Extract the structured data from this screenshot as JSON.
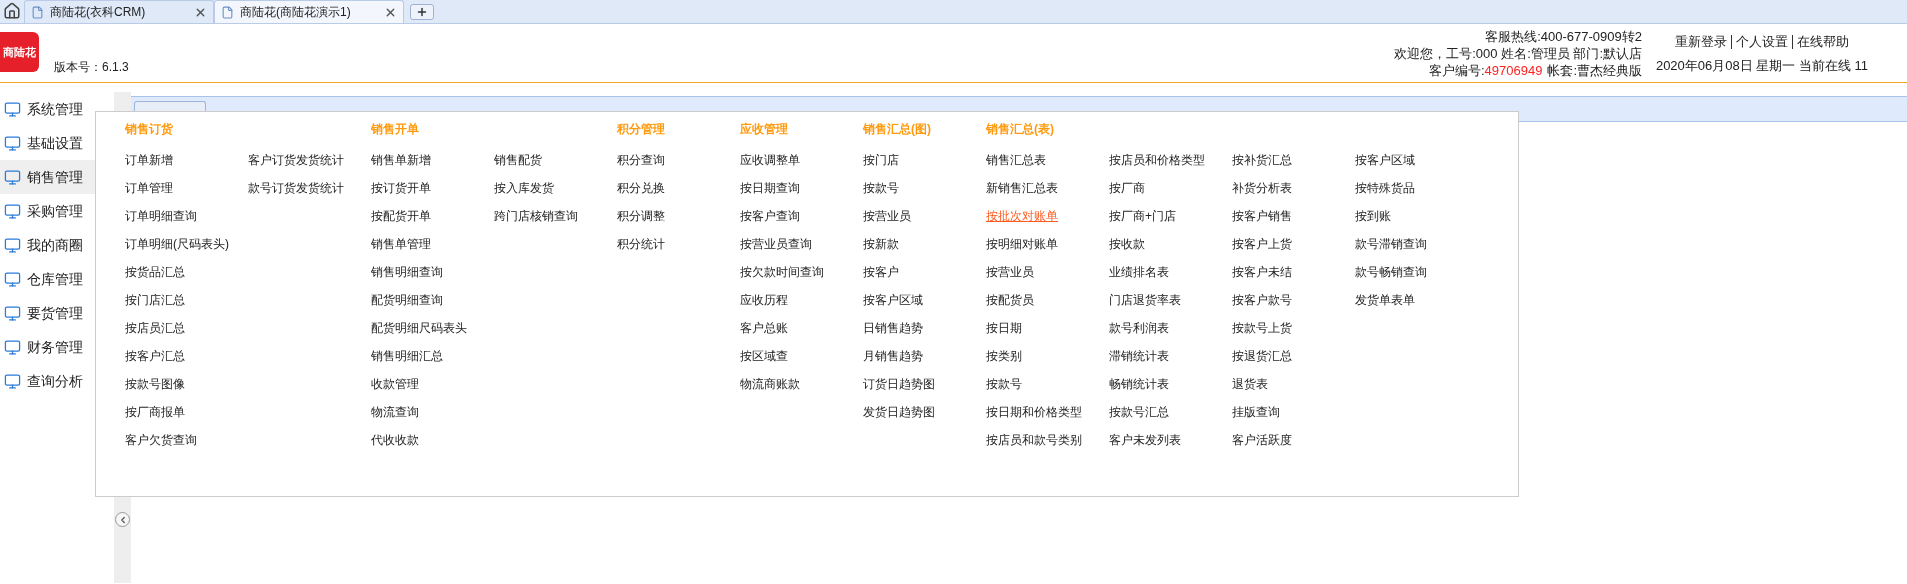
{
  "browser_tabs": [
    {
      "title": "商陆花(衣科CRM)",
      "selected": false
    },
    {
      "title": "商陆花(商陆花演示1)",
      "selected": true
    }
  ],
  "header": {
    "logo": "商陆花",
    "version": "版本号：6.1.3",
    "hotline": "客服热线:400-677-0909转2",
    "welcome": "欢迎您，工号:000 姓名:管理员 部门:默认店",
    "customer_label": "客户编号:",
    "customer_no": "49706949",
    "account": "帐套:曹杰经典版",
    "links": [
      "重新登录",
      "个人设置",
      "在线帮助"
    ],
    "date_line": "2020年06月08日 星期一 当前在线 11"
  },
  "sidebar": {
    "items": [
      {
        "label": "系统管理",
        "selected": false
      },
      {
        "label": "基础设置",
        "selected": false
      },
      {
        "label": "销售管理",
        "selected": true
      },
      {
        "label": "采购管理",
        "selected": false
      },
      {
        "label": "我的商圈",
        "selected": false
      },
      {
        "label": "仓库管理",
        "selected": false
      },
      {
        "label": "要货管理",
        "selected": false
      },
      {
        "label": "财务管理",
        "selected": false
      },
      {
        "label": "查询分析",
        "selected": false
      }
    ]
  },
  "menu": {
    "groups": [
      {
        "title": "销售订货",
        "columns": [
          [
            {
              "label": "订单新增",
              "selected": false
            },
            {
              "label": "订单管理",
              "selected": false
            },
            {
              "label": "订单明细查询",
              "selected": false
            },
            {
              "label": "订单明细(尺码表头)",
              "selected": false
            },
            {
              "label": "按货品汇总",
              "selected": false
            },
            {
              "label": "按门店汇总",
              "selected": false
            },
            {
              "label": "按店员汇总",
              "selected": false
            },
            {
              "label": "按客户汇总",
              "selected": false
            },
            {
              "label": "按款号图像",
              "selected": false
            },
            {
              "label": "按厂商报单",
              "selected": false
            },
            {
              "label": "客户欠货查询",
              "selected": false
            }
          ],
          [
            {
              "label": "客户订货发货统计",
              "selected": false
            },
            {
              "label": "款号订货发货统计",
              "selected": false
            }
          ]
        ]
      },
      {
        "title": "销售开单",
        "columns": [
          [
            {
              "label": "销售单新增",
              "selected": false
            },
            {
              "label": "按订货开单",
              "selected": false
            },
            {
              "label": "按配货开单",
              "selected": false
            },
            {
              "label": "销售单管理",
              "selected": false
            },
            {
              "label": "销售明细查询",
              "selected": false
            },
            {
              "label": "配货明细查询",
              "selected": false
            },
            {
              "label": "配货明细尺码表头",
              "selected": false
            },
            {
              "label": "销售明细汇总",
              "selected": false
            },
            {
              "label": "收款管理",
              "selected": false
            },
            {
              "label": "物流查询",
              "selected": false
            },
            {
              "label": "代收收款",
              "selected": false
            }
          ],
          [
            {
              "label": "销售配货",
              "selected": false
            },
            {
              "label": "按入库发货",
              "selected": false
            },
            {
              "label": "跨门店核销查询",
              "selected": false
            }
          ]
        ]
      },
      {
        "title": "积分管理",
        "columns": [
          [
            {
              "label": "积分查询",
              "selected": false
            },
            {
              "label": "积分兑换",
              "selected": false
            },
            {
              "label": "积分调整",
              "selected": false
            },
            {
              "label": "积分统计",
              "selected": false
            }
          ]
        ]
      },
      {
        "title": "应收管理",
        "columns": [
          [
            {
              "label": "应收调整单",
              "selected": false
            },
            {
              "label": "按日期查询",
              "selected": false
            },
            {
              "label": "按客户查询",
              "selected": false
            },
            {
              "label": "按营业员查询",
              "selected": false
            },
            {
              "label": "按欠款时间查询",
              "selected": false
            },
            {
              "label": "应收历程",
              "selected": false
            },
            {
              "label": "客户总账",
              "selected": false
            },
            {
              "label": "按区域查",
              "selected": false
            },
            {
              "label": "物流商账款",
              "selected": false
            }
          ]
        ]
      },
      {
        "title": "销售汇总(图)",
        "columns": [
          [
            {
              "label": "按门店",
              "selected": false
            },
            {
              "label": "按款号",
              "selected": false
            },
            {
              "label": "按营业员",
              "selected": false
            },
            {
              "label": "按新款",
              "selected": false
            },
            {
              "label": "按客户",
              "selected": false
            },
            {
              "label": "按客户区域",
              "selected": false
            },
            {
              "label": "日销售趋势",
              "selected": false
            },
            {
              "label": "月销售趋势",
              "selected": false
            },
            {
              "label": "订货日趋势图",
              "selected": false
            },
            {
              "label": "发货日趋势图",
              "selected": false
            }
          ]
        ]
      },
      {
        "title": "销售汇总(表)",
        "columns": [
          [
            {
              "label": "销售汇总表",
              "selected": false
            },
            {
              "label": "新销售汇总表",
              "selected": false
            },
            {
              "label": "按批次对账单",
              "selected": true
            },
            {
              "label": "按明细对账单",
              "selected": false
            },
            {
              "label": "按营业员",
              "selected": false
            },
            {
              "label": "按配货员",
              "selected": false
            },
            {
              "label": "按日期",
              "selected": false
            },
            {
              "label": "按类别",
              "selected": false
            },
            {
              "label": "按款号",
              "selected": false
            },
            {
              "label": "按日期和价格类型",
              "selected": false
            },
            {
              "label": "按店员和款号类别",
              "selected": false
            }
          ],
          [
            {
              "label": "按店员和价格类型",
              "selected": false
            },
            {
              "label": "按厂商",
              "selected": false
            },
            {
              "label": "按厂商+门店",
              "selected": false
            },
            {
              "label": "按收款",
              "selected": false
            },
            {
              "label": "业绩排名表",
              "selected": false
            },
            {
              "label": "门店退货率表",
              "selected": false
            },
            {
              "label": "款号利润表",
              "selected": false
            },
            {
              "label": "滞销统计表",
              "selected": false
            },
            {
              "label": "畅销统计表",
              "selected": false
            },
            {
              "label": "按款号汇总",
              "selected": false
            },
            {
              "label": "客户未发列表",
              "selected": false
            }
          ],
          [
            {
              "label": "按补货汇总",
              "selected": false
            },
            {
              "label": "补货分析表",
              "selected": false
            },
            {
              "label": "按客户销售",
              "selected": false
            },
            {
              "label": "按客户上货",
              "selected": false
            },
            {
              "label": "按客户未结",
              "selected": false
            },
            {
              "label": "按客户款号",
              "selected": false
            },
            {
              "label": "按款号上货",
              "selected": false
            },
            {
              "label": "按退货汇总",
              "selected": false
            },
            {
              "label": "退货表",
              "selected": false
            },
            {
              "label": "挂版查询",
              "selected": false
            },
            {
              "label": "客户活跃度",
              "selected": false
            }
          ],
          [
            {
              "label": "按客户区域",
              "selected": false
            },
            {
              "label": "按特殊货品",
              "selected": false
            },
            {
              "label": "按到账",
              "selected": false
            },
            {
              "label": "款号滞销查询",
              "selected": false
            },
            {
              "label": "款号畅销查询",
              "selected": false
            },
            {
              "label": "发货单表单",
              "selected": false
            }
          ]
        ]
      }
    ]
  }
}
